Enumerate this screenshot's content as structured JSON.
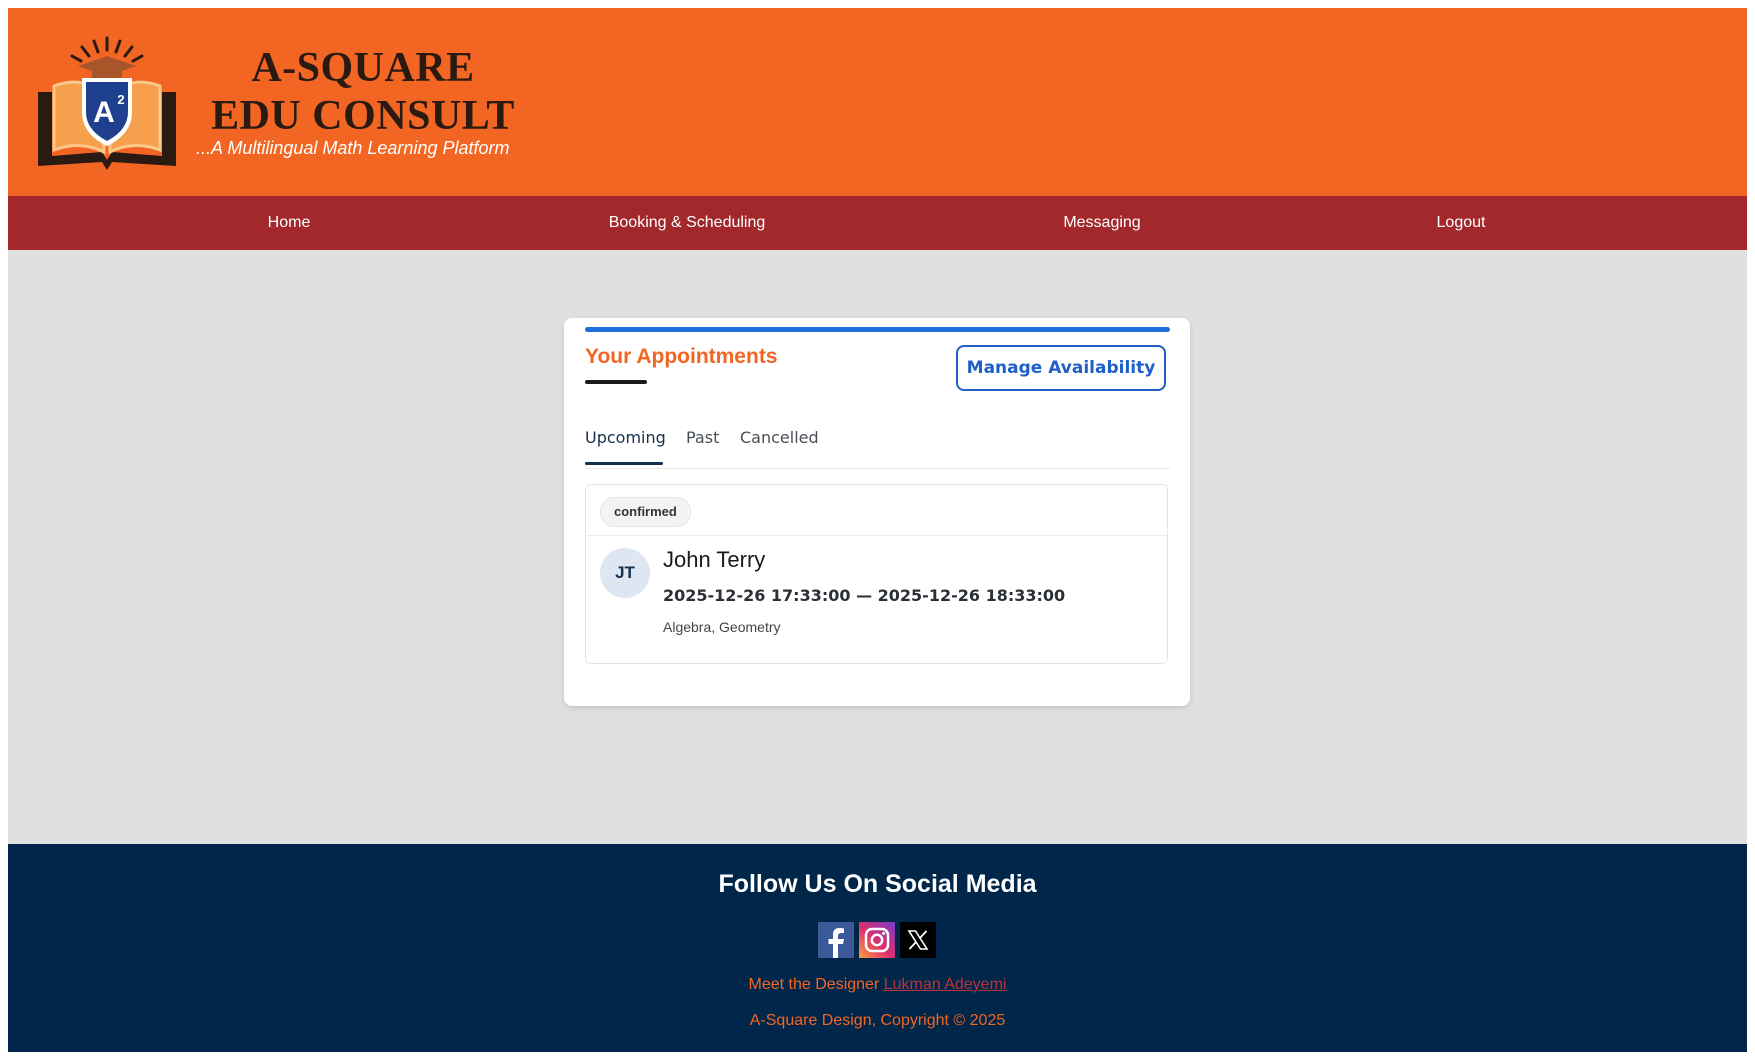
{
  "brand": {
    "title_line1": "A-SQUARE",
    "title_line2": "EDU CONSULT",
    "tagline": "...A Multilingual Math Learning Platform",
    "logo_text": "A",
    "logo_superscript": "2"
  },
  "nav": {
    "items": [
      {
        "label": "Home"
      },
      {
        "label": "Booking & Scheduling"
      },
      {
        "label": "Messaging"
      },
      {
        "label": "Logout"
      }
    ]
  },
  "appointments": {
    "title": "Your Appointments",
    "manage_button": "Manage Availability",
    "tabs": [
      {
        "label": "Upcoming",
        "active": true
      },
      {
        "label": "Past",
        "active": false
      },
      {
        "label": "Cancelled",
        "active": false
      }
    ],
    "items": [
      {
        "status": "confirmed",
        "initials": "JT",
        "name": "John Terry",
        "time_range": "2025-12-26 17:33:00 — 2025-12-26 18:33:00",
        "subjects": "Algebra, Geometry"
      }
    ]
  },
  "footer": {
    "title": "Follow Us On Social Media",
    "socials": [
      {
        "icon": "facebook-icon"
      },
      {
        "icon": "instagram-icon"
      },
      {
        "icon": "x-icon"
      }
    ],
    "designer_prefix": "Meet the Designer",
    "designer_name": "Lukman Adeyemi",
    "copyright": "A-Square Design, Copyright © 2025"
  },
  "colors": {
    "header_bg": "#f26522",
    "nav_bg": "#a2282b",
    "page_bg": "#e0e0e0",
    "footer_bg": "#00264a",
    "accent_blue": "#1e6fd9"
  }
}
